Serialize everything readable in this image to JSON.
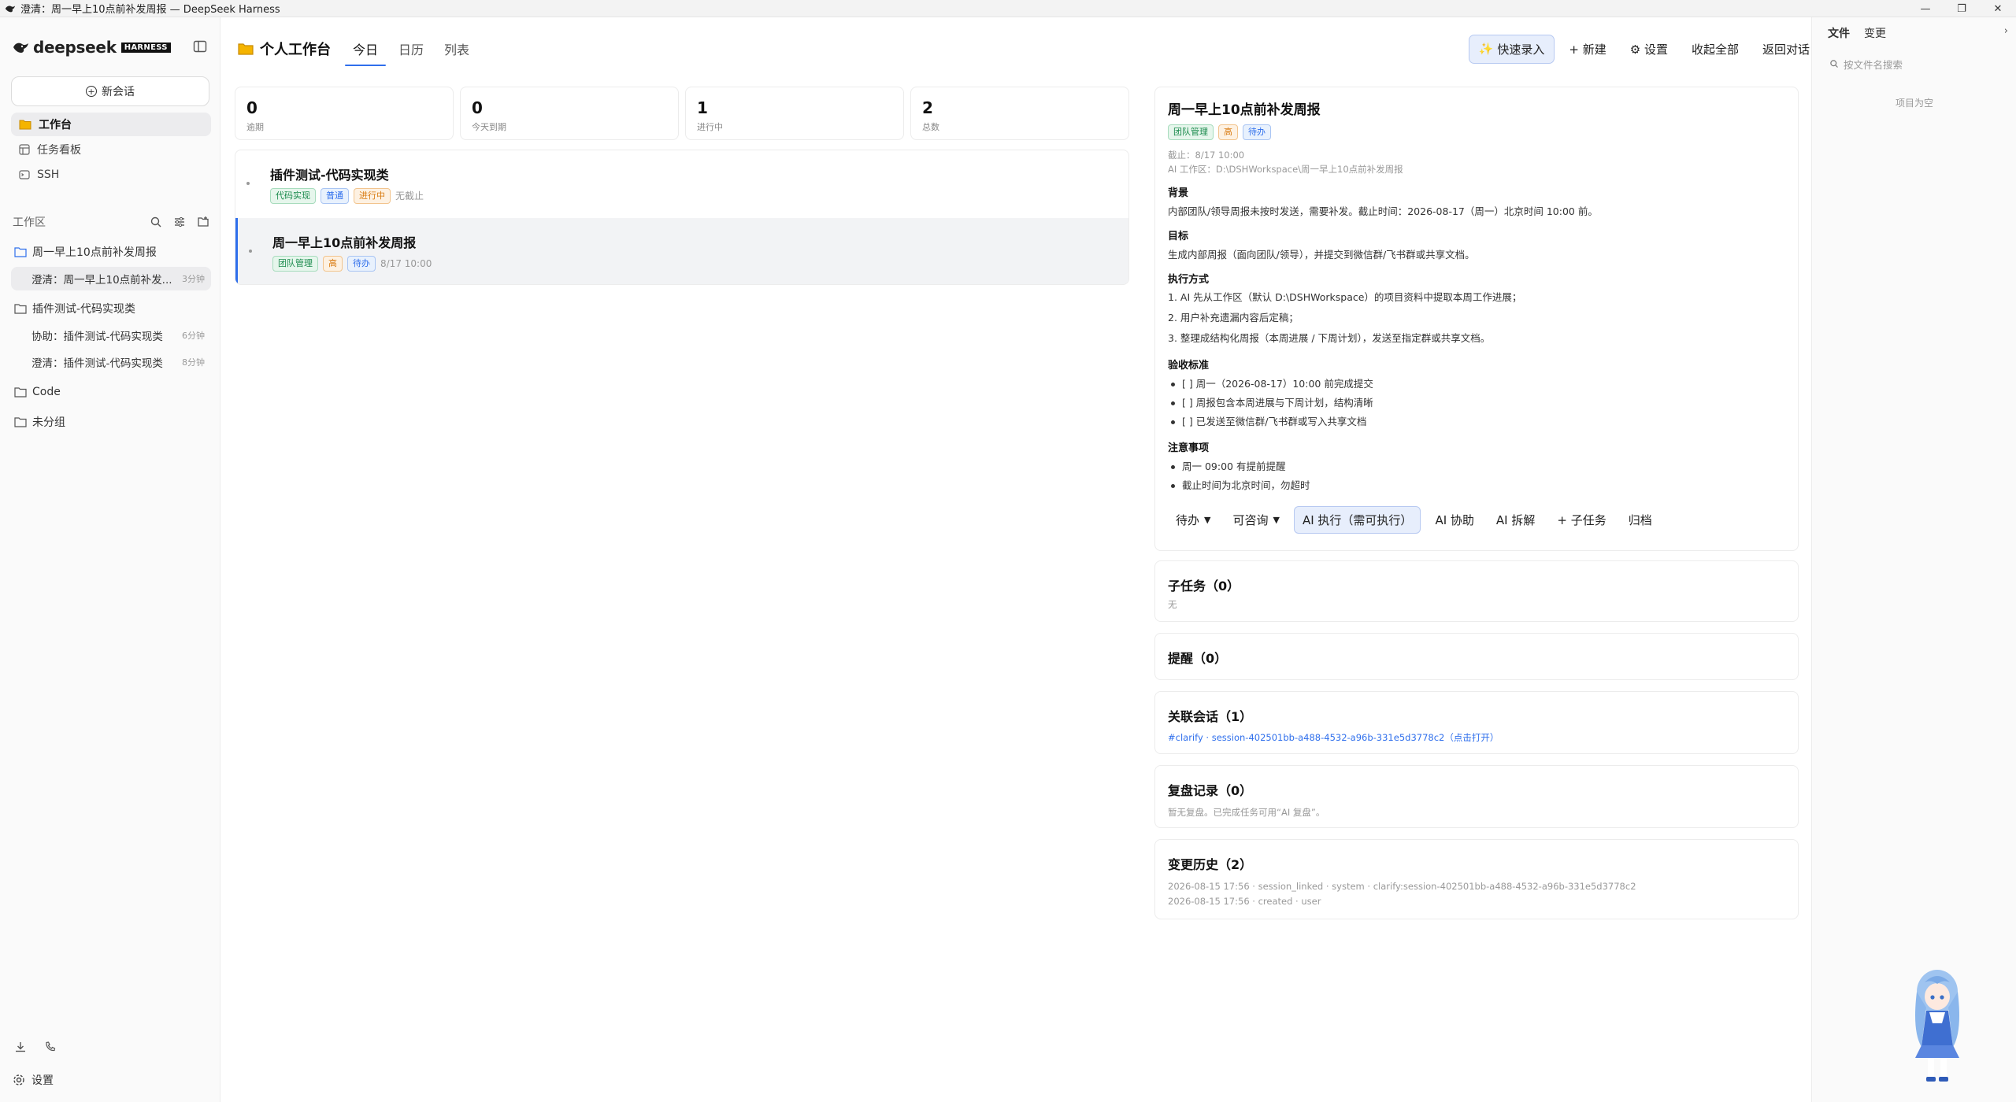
{
  "window": {
    "title": "澄清：周一早上10点前补发周报 — DeepSeek Harness"
  },
  "brand": {
    "name": "deepseek",
    "badge": "HARNESS"
  },
  "sidebar": {
    "new_chat": "新会话",
    "nav": [
      {
        "label": "工作台",
        "icon": "folder-icon",
        "active": true
      },
      {
        "label": "任务看板",
        "icon": "board-icon",
        "active": false
      },
      {
        "label": "SSH",
        "icon": "terminal-icon",
        "active": false
      }
    ],
    "workspace_label": "工作区",
    "groups": [
      {
        "name": "周一早上10点前补发周报",
        "children": [
          {
            "title": "澄清：周一早上10点前补发...",
            "ago": "3分钟"
          }
        ]
      },
      {
        "name": "插件测试-代码实现类",
        "children": [
          {
            "title": "协助：插件测试-代码实现类",
            "ago": "6分钟"
          },
          {
            "title": "澄清：插件测试-代码实现类",
            "ago": "8分钟"
          }
        ]
      },
      {
        "name": "Code",
        "children": []
      },
      {
        "name": "未分组",
        "children": []
      }
    ],
    "settings": "设置"
  },
  "header": {
    "title": "个人工作台",
    "tabs": [
      "今日",
      "日历",
      "列表"
    ],
    "actions": {
      "quick_add": "快速录入",
      "new": "+ 新建",
      "settings": "⚙ 设置",
      "collapse_all": "收起全部",
      "back": "返回对话"
    }
  },
  "stats": [
    {
      "value": "0",
      "label": "逾期"
    },
    {
      "value": "0",
      "label": "今天到期"
    },
    {
      "value": "1",
      "label": "进行中"
    },
    {
      "value": "2",
      "label": "总数"
    }
  ],
  "tasks": [
    {
      "title": "插件测试-代码实现类",
      "tags": [
        "代码实现",
        "普通",
        "进行中"
      ],
      "due": "无截止"
    },
    {
      "title": "周一早上10点前补发周报",
      "tags": [
        "团队管理",
        "高",
        "待办"
      ],
      "due": "8/17 10:00"
    }
  ],
  "detail": {
    "title": "周一早上10点前补发周报",
    "tags": [
      "团队管理",
      "高",
      "待办"
    ],
    "due": "截止：8/17 10:00",
    "workspace": "AI 工作区：D:\\DSHWorkspace\\周一早上10点前补发周报",
    "sections": {
      "background_h": "背景",
      "background": "内部团队/领导周报未按时发送，需要补发。截止时间：2026-08-17（周一）北京时间 10:00 前。",
      "goal_h": "目标",
      "goal": "生成内部周报（面向团队/领导），并提交到微信群/飞书群或共享文档。",
      "method_h": "执行方式",
      "method": [
        "1. AI 先从工作区（默认 D:\\DSHWorkspace）的项目资料中提取本周工作进展；",
        "2. 用户补充遗漏内容后定稿；",
        "3. 整理成结构化周报（本周进展 / 下周计划），发送至指定群或共享文档。"
      ],
      "criteria_h": "验收标准",
      "criteria": [
        "[ ] 周一（2026-08-17）10:00 前完成提交",
        "[ ] 周报包含本周进展与下周计划，结构清晰",
        "[ ] 已发送至微信群/飞书群或写入共享文档"
      ],
      "notes_h": "注意事项",
      "notes": [
        "周一 09:00 有提前提醒",
        "截止时间为北京时间，勿超时"
      ]
    },
    "actions": {
      "status": "待办",
      "consult": "可咨询",
      "ai_exec": "AI 执行（需可执行）",
      "ai_assist": "AI 协助",
      "ai_split": "AI 拆解",
      "subtask": "+ 子任务",
      "archive": "归档"
    }
  },
  "panels": {
    "subtasks_title": "子任务（0）",
    "subtasks_empty": "无",
    "reminders_title": "提醒（0）",
    "sessions_title": "关联会话（1）",
    "session_link": "#clarify · session-402501bb-a488-4532-a96b-331e5d3778c2（点击打开）",
    "review_title": "复盘记录（0）",
    "review_empty": "暂无复盘。已完成任务可用“AI 复盘”。",
    "history_title": "变更历史（2）",
    "history": [
      "2026-08-15 17:56 · session_linked · system · clarify:session-402501bb-a488-4532-a96b-331e5d3778c2",
      "2026-08-15 17:56 · created · user"
    ]
  },
  "filepanel": {
    "tabs": [
      "文件",
      "变更"
    ],
    "search_placeholder": "按文件名搜索",
    "empty": "项目为空"
  },
  "colors": {
    "accent": "#2f6fec",
    "tag_green": "#1a8a4c",
    "tag_blue": "#2f6fec",
    "tag_orange": "#d87a10"
  }
}
